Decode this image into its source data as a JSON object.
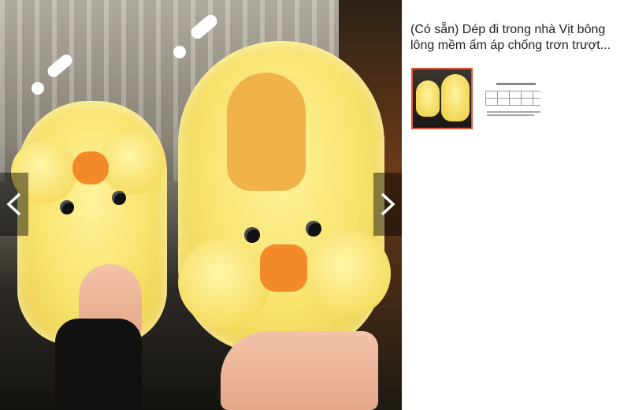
{
  "product": {
    "title": "(Có sẵn) Dép đi trong nhà Vịt bông lông mềm ấm áp chống trơn trượt..."
  },
  "carousel": {
    "prev_icon": "chevron-left-icon",
    "next_icon": "chevron-right-icon"
  },
  "thumbnails": [
    {
      "kind": "photo",
      "active": true
    },
    {
      "kind": "size-chart",
      "active": false
    }
  ],
  "colors": {
    "thumb_active_border": "#e0563b",
    "slipper_yellow": "#f7e26a",
    "beak_orange": "#f28a2a"
  }
}
